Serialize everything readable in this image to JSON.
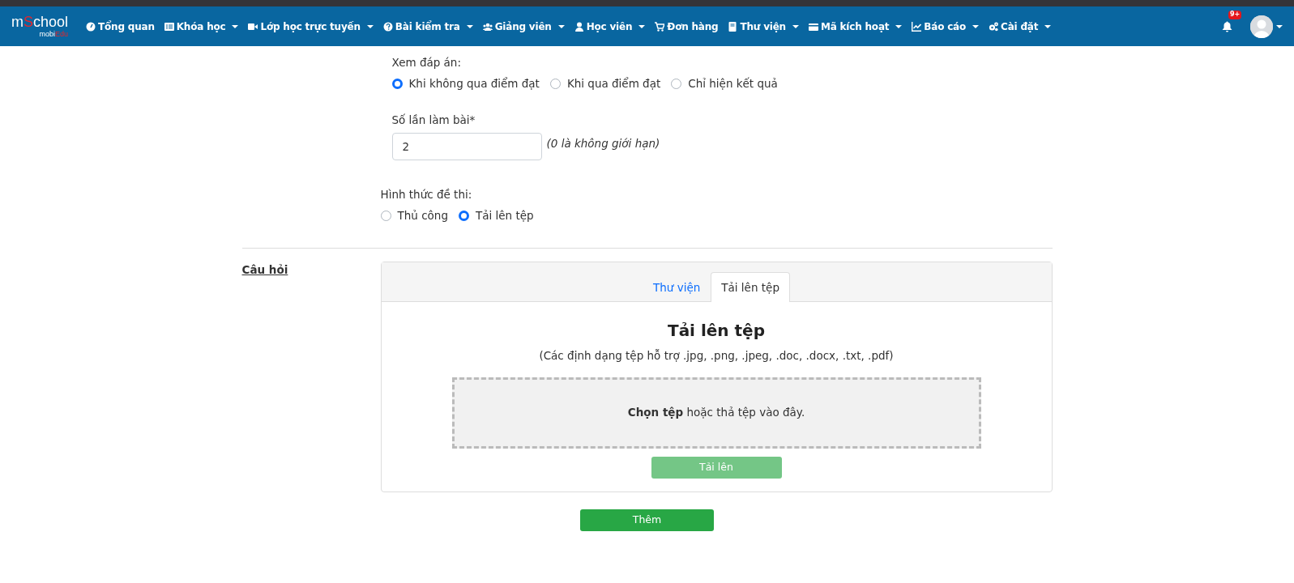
{
  "navbar": {
    "logo": {
      "parts": [
        {
          "text": "m",
          "accent": false
        },
        {
          "text": "S",
          "accent": true
        },
        {
          "text": "chool",
          "accent": false
        }
      ],
      "sub_parts": [
        {
          "text": "mobi",
          "accent": false
        },
        {
          "text": "Edu",
          "accent": true
        }
      ]
    },
    "items": [
      {
        "label": "Tổng quan",
        "dropdown": false
      },
      {
        "label": "Khóa học",
        "dropdown": true
      },
      {
        "label": "Lớp học trực tuyến",
        "dropdown": true
      },
      {
        "label": "Bài kiểm tra",
        "dropdown": true
      },
      {
        "label": "Giảng viên",
        "dropdown": true
      },
      {
        "label": "Học viên",
        "dropdown": true
      },
      {
        "label": "Đơn hàng",
        "dropdown": false
      },
      {
        "label": "Thư viện",
        "dropdown": true
      },
      {
        "label": "Mã kích hoạt",
        "dropdown": true
      },
      {
        "label": "Báo cáo",
        "dropdown": true
      },
      {
        "label": "Cài đặt",
        "dropdown": true
      }
    ],
    "notification_count": "9+"
  },
  "answer_view": {
    "label": "Xem đáp án:",
    "options": [
      {
        "label": "Khi không qua điểm đạt",
        "selected": true
      },
      {
        "label": "Khi qua điểm đạt",
        "selected": false
      },
      {
        "label": "Chỉ hiện kết quả",
        "selected": false
      }
    ]
  },
  "attempts": {
    "label": "Số lần làm bài*",
    "value": "2",
    "hint": "(0 là không giới hạn)"
  },
  "exam_format": {
    "label": "Hình thức đề thi:",
    "options": [
      {
        "label": "Thủ công",
        "selected": false
      },
      {
        "label": "Tải lên tệp",
        "selected": true
      }
    ]
  },
  "questions": {
    "label": "Câu hỏi",
    "tabs": [
      {
        "label": "Thư viện",
        "selected": false
      },
      {
        "label": "Tải lên tệp",
        "selected": true
      }
    ],
    "upload": {
      "title": "Tải lên tệp",
      "formats": "(Các định dạng tệp hỗ trợ .jpg, .png, .jpeg, .doc, .docx, .txt, .pdf)",
      "dropzone_text": "**Chọn tệp** hoặc thả tệp vào đây.",
      "button": {
        "label": "Tải lên",
        "disabled": true
      }
    }
  },
  "submit_button": "Thêm"
}
